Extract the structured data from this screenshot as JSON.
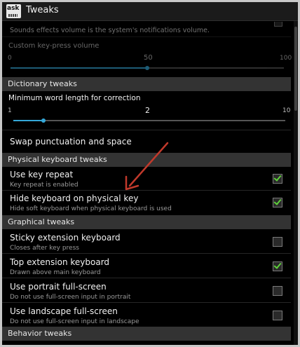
{
  "app": {
    "title": "Tweaks",
    "icon_text": "ask"
  },
  "top_partial": {
    "sounds_note": "Sounds effects volume is the system's notifications volume.",
    "custom_keypress_label": "Custom key-press volume",
    "slider": {
      "min": "0",
      "mid": "50",
      "max": "100",
      "value_fraction": 0.5
    }
  },
  "dictionary": {
    "header": "Dictionary tweaks",
    "min_word_label": "Minimum word length for correction",
    "slider": {
      "min": "1",
      "value": "2",
      "max": "10",
      "value_fraction": 0.111
    },
    "swap_label": "Swap punctuation and space"
  },
  "physical": {
    "header": "Physical keyboard tweaks",
    "items": [
      {
        "title": "Use key repeat",
        "subtitle": "Key repeat is enabled",
        "checked": true
      },
      {
        "title": "Hide keyboard on physical key",
        "subtitle": "Hide soft keyboard when physical keyboard is used",
        "checked": true
      }
    ]
  },
  "graphical": {
    "header": "Graphical tweaks",
    "items": [
      {
        "title": "Sticky extension keyboard",
        "subtitle": "Closes after key press",
        "checked": false
      },
      {
        "title": "Top extension keyboard",
        "subtitle": "Drawn above main keyboard",
        "checked": true
      },
      {
        "title": "Use portrait full-screen",
        "subtitle": "Do not use full-screen input in portrait",
        "checked": false
      },
      {
        "title": "Use landscape full-screen",
        "subtitle": "Do not use full-screen input in landscape",
        "checked": false
      }
    ]
  },
  "behavior": {
    "header": "Behavior tweaks"
  },
  "colors": {
    "accent": "#35a8d8",
    "check": "#5fd13b",
    "arrow": "#c0392b",
    "section_bg": "#333333"
  }
}
